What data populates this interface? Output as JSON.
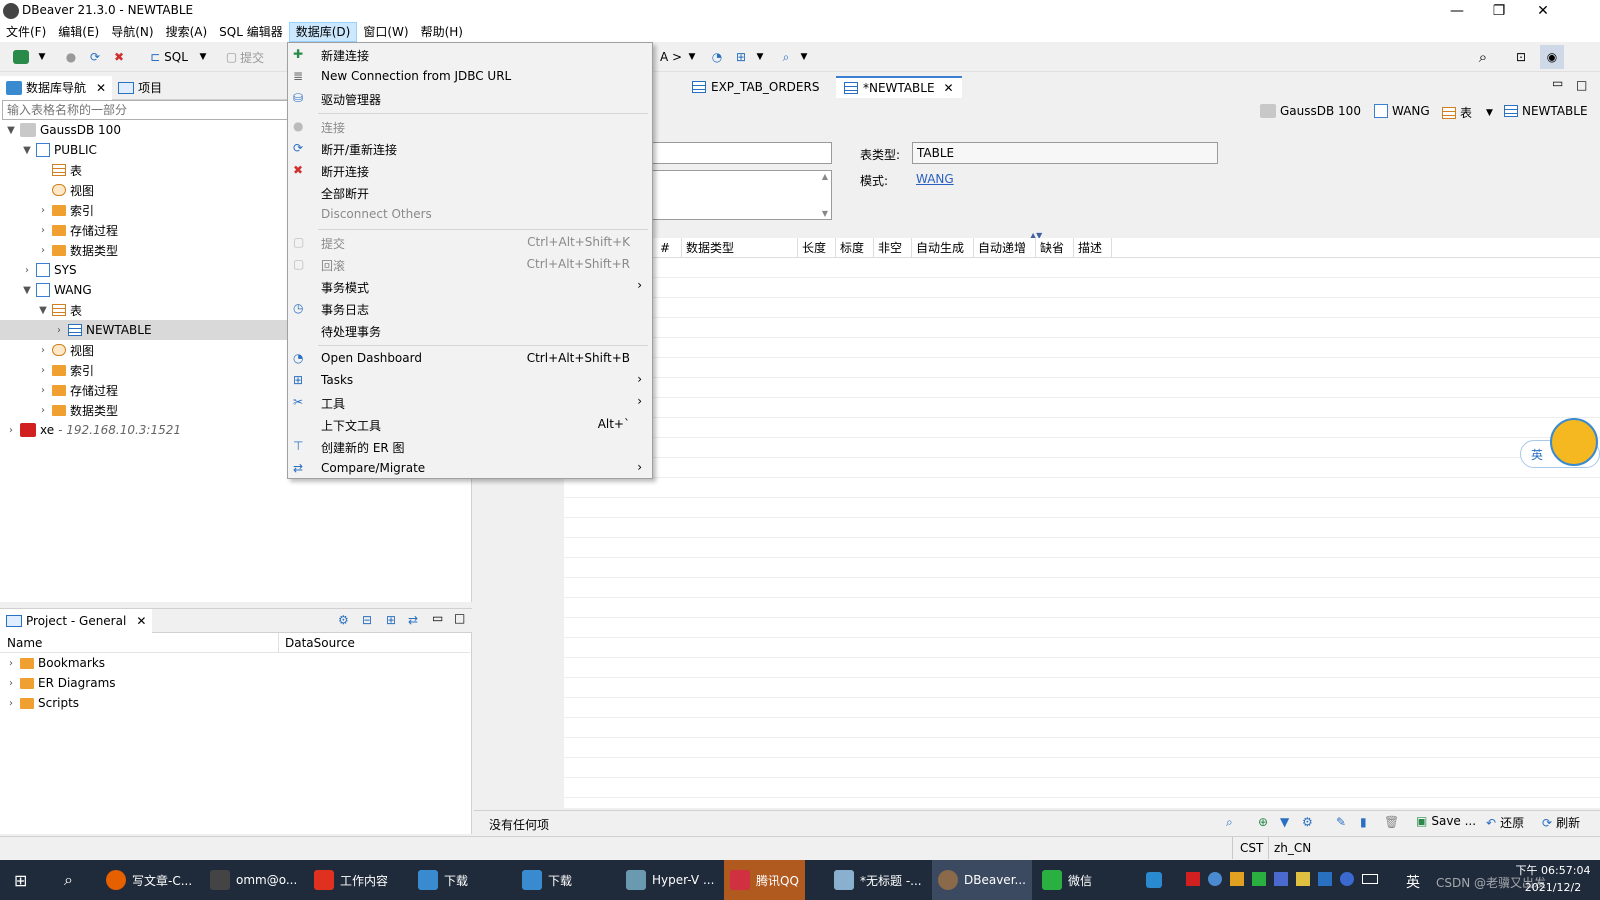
{
  "window": {
    "title": "DBeaver 21.3.0 - NEWTABLE",
    "min": "—",
    "max": "❐",
    "close": "✕"
  },
  "menubar": [
    "文件(F)",
    "编辑(E)",
    "导航(N)",
    "搜索(A)",
    "SQL 编辑器",
    "数据库(D)",
    "窗口(W)",
    "帮助(H)"
  ],
  "toolbar": {
    "sql": "SQL",
    "commit": "提交",
    "a_label": "A >"
  },
  "nav_panel": {
    "tabs": [
      "数据库导航",
      "项目"
    ],
    "filter_placeholder": "输入表格名称的一部分",
    "tree": {
      "gaussdb": "GaussDB 100",
      "public": "PUBLIC",
      "public_children": [
        "表",
        "视图",
        "索引",
        "存储过程",
        "数据类型"
      ],
      "sys": "SYS",
      "wang": "WANG",
      "wang_table": "表",
      "newtable": "NEWTABLE",
      "wang_children": [
        "视图",
        "索引",
        "存储过程",
        "数据类型"
      ],
      "xe": "xe",
      "xe_host": " - 192.168.10.3:1521"
    }
  },
  "project_panel": {
    "title": "Project - General",
    "col_name": "Name",
    "col_datasource": "DataSource",
    "items": [
      "Bookmarks",
      "ER Diagrams",
      "Scripts"
    ]
  },
  "editor": {
    "tabs": [
      "EXP_TAB_ORDERS",
      "*NEWTABLE"
    ],
    "breadcrumb": {
      "db": "GaussDB 100",
      "schema": "WANG",
      "folder": "表",
      "table": "NEWTABLE"
    },
    "table_type_label": "表类型:",
    "table_type_value": "TABLE",
    "schema_label": "模式:",
    "schema_value": "WANG",
    "columns": [
      "#",
      "数据类型",
      "长度",
      "标度",
      "非空",
      "自动生成",
      "自动递增",
      "缺省",
      "描述"
    ],
    "empty_text": "没有任何项",
    "save": "Save ...",
    "revert": "还原",
    "refresh": "刷新"
  },
  "db_menu": {
    "items": [
      {
        "label": "新建连接",
        "shortcut": "",
        "disabled": false,
        "submenu": false
      },
      {
        "label": "New Connection from JDBC URL",
        "shortcut": "",
        "disabled": false,
        "submenu": false
      },
      {
        "label": "驱动管理器",
        "shortcut": "",
        "disabled": false,
        "submenu": false
      },
      {
        "label": "连接",
        "shortcut": "",
        "disabled": true,
        "submenu": false
      },
      {
        "label": "断开/重新连接",
        "shortcut": "",
        "disabled": false,
        "submenu": false
      },
      {
        "label": "断开连接",
        "shortcut": "",
        "disabled": false,
        "submenu": false
      },
      {
        "label": "全部断开",
        "shortcut": "",
        "disabled": false,
        "submenu": false
      },
      {
        "label": "Disconnect Others",
        "shortcut": "",
        "disabled": true,
        "submenu": false
      },
      {
        "label": "提交",
        "shortcut": "Ctrl+Alt+Shift+K",
        "disabled": true,
        "submenu": false
      },
      {
        "label": "回滚",
        "shortcut": "Ctrl+Alt+Shift+R",
        "disabled": true,
        "submenu": false
      },
      {
        "label": "事务模式",
        "shortcut": "",
        "disabled": false,
        "submenu": true
      },
      {
        "label": "事务日志",
        "shortcut": "",
        "disabled": false,
        "submenu": false
      },
      {
        "label": "待处理事务",
        "shortcut": "",
        "disabled": false,
        "submenu": false
      },
      {
        "label": "Open Dashboard",
        "shortcut": "Ctrl+Alt+Shift+B",
        "disabled": false,
        "submenu": false
      },
      {
        "label": "Tasks",
        "shortcut": "",
        "disabled": false,
        "submenu": true
      },
      {
        "label": "工具",
        "shortcut": "",
        "disabled": false,
        "submenu": true
      },
      {
        "label": "上下文工具",
        "shortcut": "Alt+`",
        "disabled": false,
        "submenu": false
      },
      {
        "label": "创建新的 ER 图",
        "shortcut": "",
        "disabled": false,
        "submenu": false
      },
      {
        "label": "Compare/Migrate",
        "shortcut": "",
        "disabled": false,
        "submenu": true
      }
    ]
  },
  "statusbar": {
    "tz": "CST",
    "locale": "zh_CN"
  },
  "ime": "英",
  "taskbar": {
    "items": [
      "写文章-C...",
      "omm@o...",
      "工作内容",
      "下载",
      "下载",
      "Hyper-V ...",
      "腾讯QQ",
      "*无标题 -...",
      "DBeaver...",
      "微信"
    ],
    "time": "下午 06:57:04",
    "date": "2021/12/2",
    "tray_text": "CSDN @老骥又出发",
    "lang": "英"
  },
  "colors": {
    "accent": "#3a7fd0",
    "menu_highlight": "#cce8ff",
    "taskbar": "#1f2a3a",
    "folder": "#f0a030"
  }
}
